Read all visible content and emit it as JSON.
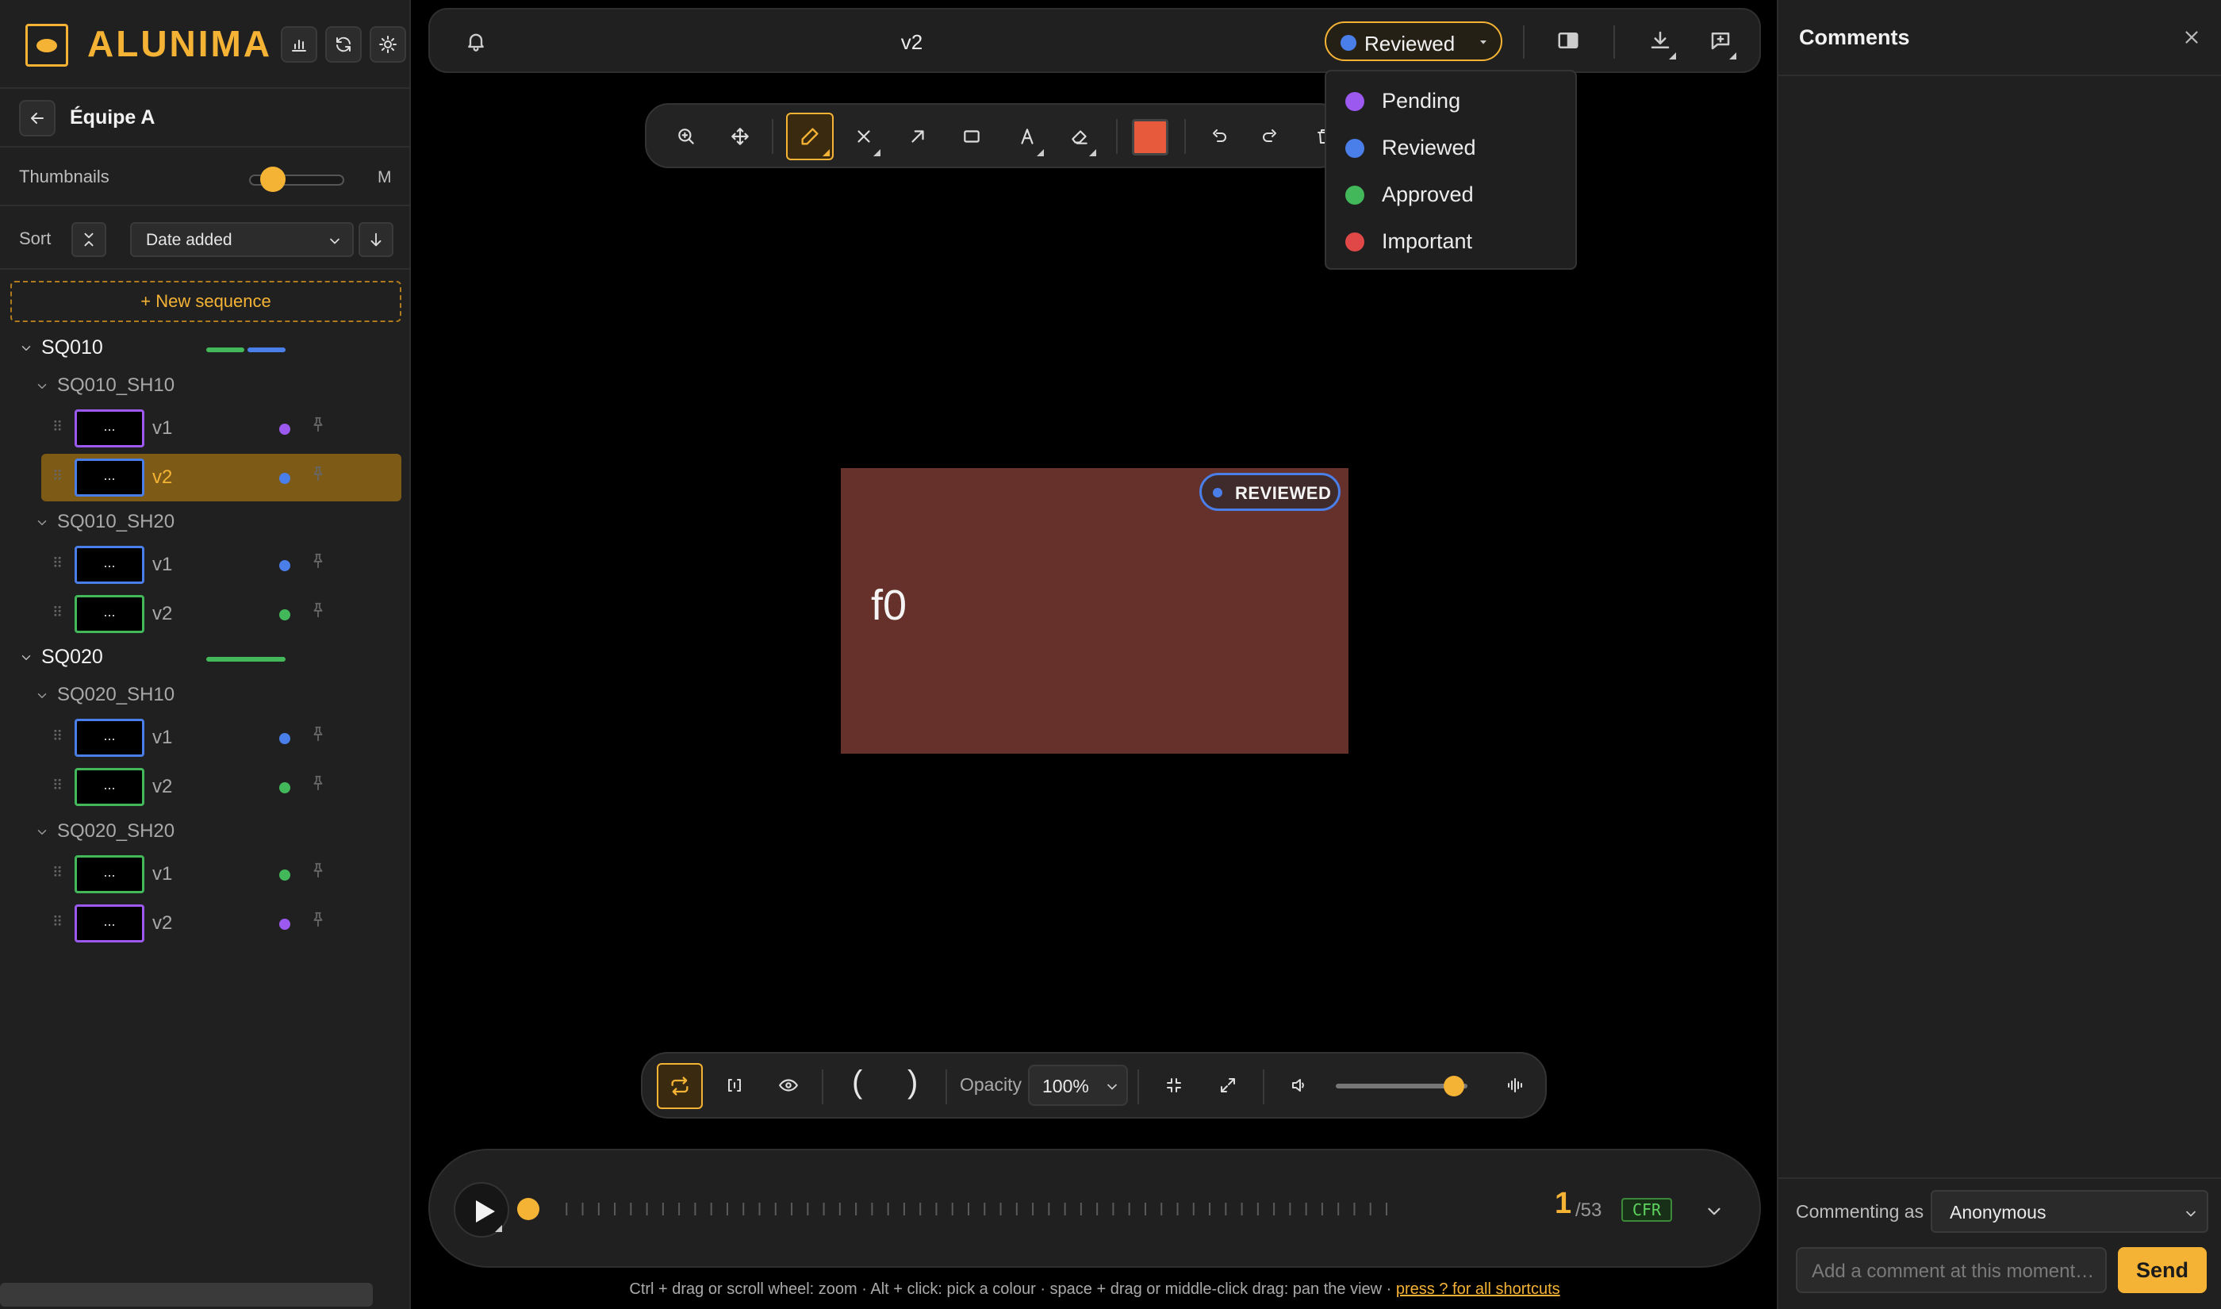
{
  "app": {
    "name": "ALUNIMA"
  },
  "team": {
    "name": "Équipe A"
  },
  "sidebar": {
    "thumbnails_label": "Thumbnails",
    "thumbnails_size": "M",
    "thumbnails_level": 0.25,
    "sort_label": "Sort",
    "sort_value": "Date added",
    "new_sequence": "+ New sequence",
    "sequences": [
      {
        "name": "SQ010",
        "shots": [
          {
            "name": "SQ010_SH10",
            "versions": [
              {
                "label": "v1",
                "status": "pending",
                "selected": false
              },
              {
                "label": "v2",
                "status": "reviewed",
                "selected": true
              }
            ]
          },
          {
            "name": "SQ010_SH20",
            "versions": [
              {
                "label": "v1",
                "status": "reviewed",
                "selected": false
              },
              {
                "label": "v2",
                "status": "approved",
                "selected": false
              }
            ]
          }
        ]
      },
      {
        "name": "SQ020",
        "shots": [
          {
            "name": "SQ020_SH10",
            "versions": [
              {
                "label": "v1",
                "status": "reviewed",
                "selected": false
              },
              {
                "label": "v2",
                "status": "approved",
                "selected": false
              }
            ]
          },
          {
            "name": "SQ020_SH20",
            "versions": [
              {
                "label": "v1",
                "status": "approved",
                "selected": false
              },
              {
                "label": "v2",
                "status": "pending",
                "selected": false
              }
            ]
          }
        ]
      }
    ],
    "thumb_placeholder": "..."
  },
  "status_colors": {
    "pending": "#9b59f0",
    "reviewed": "#4a7ee8",
    "approved": "#43b85a",
    "important": "#e04848"
  },
  "topbar": {
    "title": "v2",
    "status": "Reviewed"
  },
  "status_menu": [
    {
      "label": "Pending",
      "key": "pending"
    },
    {
      "label": "Reviewed",
      "key": "reviewed"
    },
    {
      "label": "Approved",
      "key": "approved"
    },
    {
      "label": "Important",
      "key": "important"
    }
  ],
  "drawing": {
    "color": "#e85a3c"
  },
  "frame": {
    "text": "f0",
    "badge": "REVIEWED"
  },
  "player": {
    "opacity_label": "Opacity",
    "opacity_value": "100%",
    "paren_open": "(",
    "paren_close": ")",
    "volume": 0.9
  },
  "timeline": {
    "current_frame": "1",
    "total": "/53",
    "rate_badge": "CFR",
    "frame_count": 53
  },
  "hint": {
    "text": "Ctrl + drag or scroll wheel: zoom · Alt + click: pick a colour · space + drag or middle-click drag: pan the view · ",
    "link": "press ? for all shortcuts"
  },
  "comments": {
    "title": "Comments",
    "commenting_as_label": "Commenting as",
    "commenting_as_value": "Anonymous",
    "input_placeholder": "Add a comment at this moment…",
    "send_label": "Send"
  }
}
